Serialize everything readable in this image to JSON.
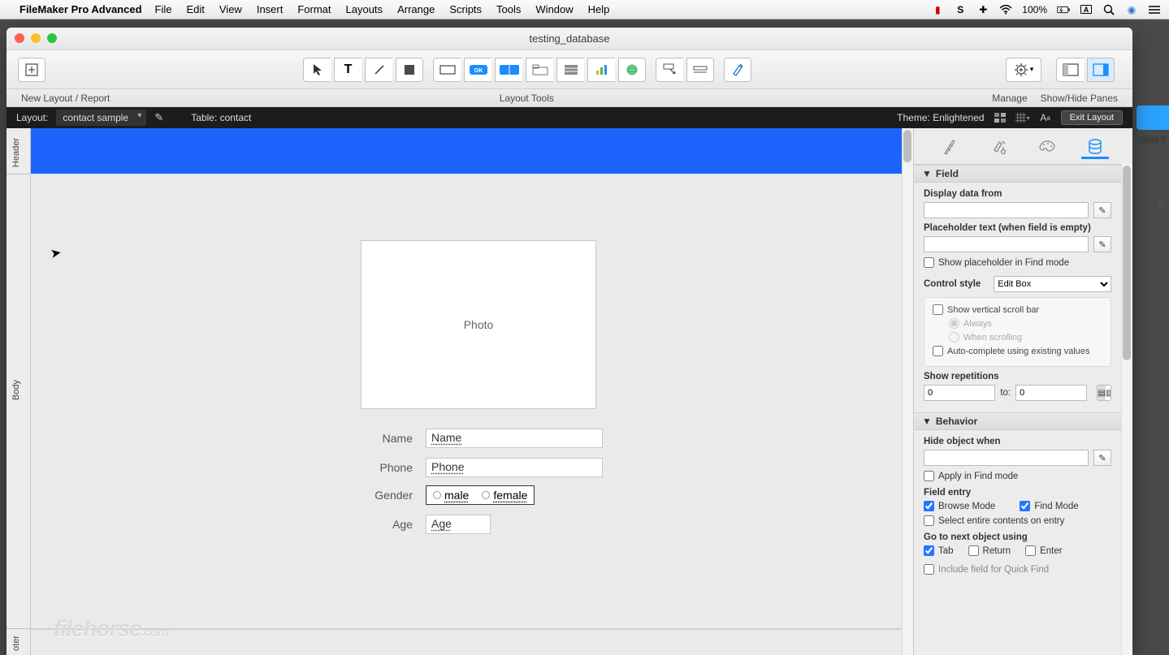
{
  "menubar": {
    "app": "FileMaker Pro Advanced",
    "items": [
      "File",
      "Edit",
      "View",
      "Insert",
      "Format",
      "Layouts",
      "Arrange",
      "Scripts",
      "Tools",
      "Window",
      "Help"
    ],
    "battery": "100%"
  },
  "window": {
    "title": "testing_database"
  },
  "toolbar": {
    "left_label": "New Layout / Report",
    "center_label": "Layout Tools",
    "manage_label": "Manage",
    "panes_label": "Show/Hide Panes"
  },
  "fmtbar": {
    "layout_label": "Layout:",
    "layout_value": "contact sample",
    "table_label": "Table: contact",
    "theme_label": "Theme: Enlightened",
    "exit_label": "Exit Layout"
  },
  "parts": {
    "header": "Header",
    "body": "Body",
    "footer": "oter"
  },
  "layout": {
    "photo": "Photo",
    "fields": {
      "name_label": "Name",
      "name_value": "Name",
      "phone_label": "Phone",
      "phone_value": "Phone",
      "gender_label": "Gender",
      "gender_opt1": "male",
      "gender_opt2": "female",
      "age_label": "Age",
      "age_value": "Age"
    }
  },
  "inspector": {
    "field_section": "Field",
    "display_from": "Display data from",
    "placeholder_label": "Placeholder text (when field is empty)",
    "show_placeholder_find": "Show placeholder in Find mode",
    "control_style_label": "Control style",
    "control_style_value": "Edit Box",
    "show_vscroll": "Show vertical scroll bar",
    "always": "Always",
    "when_scrolling": "When scrolling",
    "autocomplete": "Auto-complete using existing values",
    "show_reps": "Show repetitions",
    "rep_from": "0",
    "rep_to_label": "to:",
    "rep_to": "0",
    "behavior_section": "Behavior",
    "hide_when": "Hide object when",
    "apply_find": "Apply in Find mode",
    "field_entry": "Field entry",
    "browse_mode": "Browse Mode",
    "find_mode": "Find Mode",
    "select_entire": "Select entire contents on entry",
    "goto_next": "Go to next object using",
    "tab": "Tab",
    "return": "Return",
    "enter": "Enter",
    "include_quickfind": "Include field for Quick Find"
  },
  "watermark": {
    "main": "filehorse",
    "dom": ".com"
  },
  "bg": {
    "txt": "orial fi"
  }
}
